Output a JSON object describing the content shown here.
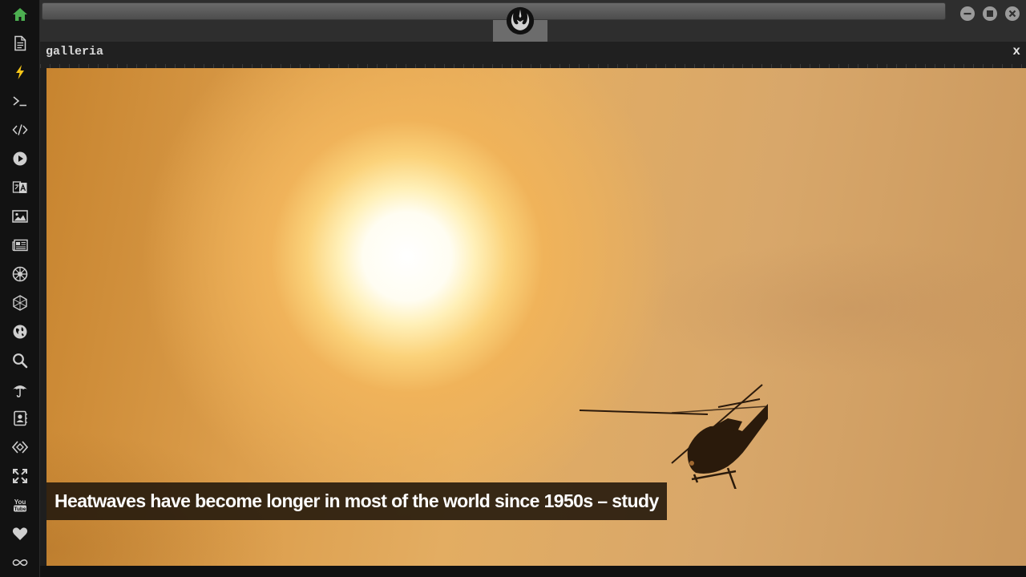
{
  "sidebar": {
    "items": [
      {
        "icon": "home-icon",
        "color": "#4caf50",
        "active": true
      },
      {
        "icon": "document-icon"
      },
      {
        "icon": "lightning-icon",
        "color": "#f5c518"
      },
      {
        "icon": "terminal-icon"
      },
      {
        "icon": "code-icon"
      },
      {
        "icon": "play-icon"
      },
      {
        "icon": "translate-icon"
      },
      {
        "icon": "image-icon"
      },
      {
        "icon": "newspaper-icon"
      },
      {
        "icon": "galactic-empire-icon"
      },
      {
        "icon": "hexagon-icon"
      },
      {
        "icon": "globe-icon"
      },
      {
        "icon": "search-icon"
      },
      {
        "icon": "umbrella-icon"
      },
      {
        "icon": "contacts-icon"
      },
      {
        "icon": "diamond-code-icon"
      },
      {
        "icon": "expand-icon"
      },
      {
        "icon": "youtube-icon"
      },
      {
        "icon": "heart-icon"
      },
      {
        "icon": "infinity-icon"
      }
    ]
  },
  "topbar": {
    "logo": "rebel-alliance-logo",
    "window_buttons": [
      "minimize",
      "maximize",
      "close"
    ]
  },
  "panel": {
    "title": "galleria",
    "close_label": "x"
  },
  "gallery": {
    "caption": "Heatwaves have become longer in most of the world since 1950s – study"
  },
  "colors": {
    "accent_home": "#4caf50",
    "accent_lightning": "#f5c518",
    "sidebar_bg": "#121212",
    "caption_bg": "#281c0e"
  }
}
